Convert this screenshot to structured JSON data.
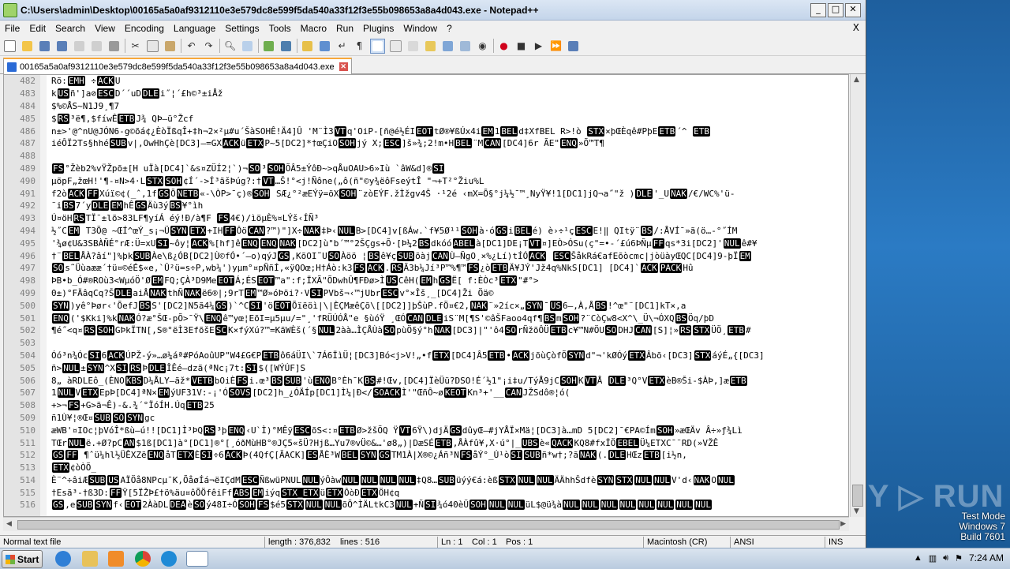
{
  "window": {
    "title": "C:\\Users\\admin\\Desktop\\00165a5a0af9312110e3e579dc8e599f5da540a33f12f3e55b098653a8a4d043.exe - Notepad++",
    "minimize": "_",
    "maximize": "□",
    "close": "✕"
  },
  "menu": [
    "File",
    "Edit",
    "Search",
    "View",
    "Encoding",
    "Language",
    "Settings",
    "Tools",
    "Macro",
    "Run",
    "Plugins",
    "Window",
    "?"
  ],
  "menu_close": "X",
  "tab": {
    "label": "00165a5a0af9312110e3e579dc8e599f5da540a33f12f3e55b098653a8a4d043.exe",
    "close": "✕"
  },
  "lines": [
    {
      "n": "482",
      "t": "Rõ:[EMH] ÷[ACK]U"
    },
    {
      "n": "483",
      "t": "k[US]ñ']a⊘[ESC]D´´uD[DLE]i˝¦´£h©³±iÅž"
    },
    {
      "n": "484",
      "t": "$%©ÅS~N1J9¸¶7"
    },
    {
      "n": "485",
      "t": "$[RS]³ë¶,$fíwÊ[ETB]J¾   QÞ—ü°Žcf"
    },
    {
      "n": "486",
      "t": "n±>'@^nU@JÓN6-g©õá¢¿ÈòÏßqÎ+‡h¬2×²µ#u´ŠàSOHÊ!Ä4]Û 'M¨Ì3[VT]q'OiP-[ñ@é½ÉI[EOT]tØ®¥ßÚx4i[EM]1[BEL]d‡XfBEL R>!ò  [STX]×þŒÈqê#PþE[ETB]´^  [ETB]"
    },
    {
      "n": "487",
      "t": "iéÔÏ2Ts§hhé[SUB]v|,OwHhÇè[DC3]—=GX[ACK]ü[ETX]P~5[DC2]*†œÇiO[SOH]jý     X;[ESC]]š»¾;2!m•H[BEL]¨M[CAN][DC4]6r ÃE\"[ENQ]»Õ™T¶"
    },
    {
      "n": "488",
      "t": ""
    },
    {
      "n": "489",
      "t": "[FS]°Žèb2%vŸŽpõ±[H    uÏà[DC4]`&s¤ZÜÍ2¦`)¬[SO]³[SOH]ÕÂ5±ÝôÐ~>qÅuOAU>6»Iù `âW&d]®[SI]"
    },
    {
      "n": "490",
      "t": "µõpF„žœH!'¶-¤N>4·L[STX][SOH]¢Í´->Í³ãšÞúg?:†[VT]…Š!°<j!Ñône(„ô(ñ\"©y¾ëôFseýtÎ  \"¬+T²°Žiu%L"
    },
    {
      "n": "491",
      "t": "f2ò[ACK][FF]Xúï©¢(_ˆ,1f[GS]Õ[NETB]«-\\ÒP>¯ç)®[SOH] SÆ¿°²æEÝÿ=öX[SOH]¨zòEÝF.žÌžgv4Š ·¹2é ‹mX=Õ§°j¼½¯™¸NyŸ¥!1[DC1]jQ¬a˝\"ž  )[DLE]'_U[NAK]/€/WC%'ü-"
    },
    {
      "n": "492",
      "t": "¨i[BS]7´y[DLE][EM]hÊ[GS]Äù3ý[BS]¥°ìh"
    },
    {
      "n": "493",
      "t": "Ú¤öH[RS]TÏ¯±lõ>83LF¶yíÁ   éý!Ð/à¶F     [FS]4€)/ìöµÈ%¤LÝš‹ÍÑ³"
    },
    {
      "n": "494",
      "t": "½˝C[EM] T3Ö@ ~ŒÍ^œÝ_s¡¬Ü[SYN][ETX]+IH[FF]Ôö[CAN]?™)\"]X÷[NAK]‡Þ‹[NUL]B>[DC4]v[ßÁw.`f¥5Ø¹¹[SOH]à·ó[GS]i[BEL]é) è›÷¹ç[ESC]E!‖  QItÿ¨[BS]/:ÅVÍ¯»ã(ö…-°˝ÍM"
    },
    {
      "n": "495",
      "t": "'¾ø¢U&3SBÀÑÉ°rÆ:Ü=xU[SI]~ôy¦[ACK]%[hf]ê[ENQ][ENQ][NAK][DC2]ù\"b´™°2ŠÇgs+Õ·[Þ¼2[BS]dkóó[ABEL]à[DC1]DE¡T[VT]¤]EÒ>ÓSu(ç\"=•-´£ú6ÞÑµ[FF]qs*3i[DC2]'[NUL]ê#¥"
    },
    {
      "n": "496",
      "t": "†¨[BEL]ÅÀ?âí\"]%þk[SUB]Àe\\ß¿ÓB[DC2]Ù©fÓ•´—o)qýJ[GS],KõOI˜U[SO]Àöö  ¦[BS]ê¥ç[SUB]õàj[CAN]Ù—ÑgO¸×%¿Lí)tÍÓ[ACK]  [ESC]ŠåkRá€afEõòcmc|jòüàyŒQC[DC4]9-þÏ[EM]"
    },
    {
      "n": "497",
      "t": "[SO]s˜Üùaææ´†ü¤©éÉ$«e,`Û²ü=s÷P,wb¼')yµm°¤pÑñÍ,«ÿQOœ;H†Áò:k3[FS][ACK].[RS]Ã3b¼Jí³P™%¶™[FS]¿ò[ETB]Ä¥JÝ'Jž4q%NkS[DC1] [DC4]`[ACK][PACK]Hû"
    },
    {
      "n": "498",
      "t": "ÞB•b_Ó#®ROù3<WµóÖ'Ø[EM]FQ;ÇÀ³D9Me[EOT]Á;ÉS[EOT]™a\":f;ÏXÃ\"ÕDwhÛ¶FÐø>Ì[US]CêH([EM]h[GS]Ë[   f:ÈÒc³[ETX]\"#°>"
    },
    {
      "n": "499",
      "t": "0±)°FÄâqCq?Š[DLE]aiÅ[NAK]thÑ[NAK]ë6®|;9rT[EM]™Ø»óÞöi?·V[SI]PVbš¬‹™jUbr[ESC]v°×Îš¸_[DC4]Ži Öä©"
    },
    {
      "n": "500",
      "t": "[SYN])yê°Þør‹'ÕefJ[BS]S'[DC2]N5ã4¼[GS])`^C[SI]'ö[EOT]Õïëöì|\\|ÈÇMæêÇõ\\[[DC2]]þŠùP.fÖ¤€2,[NAK]¨»2íc×„[SYN]¯[US]6—,À,Å[BS]!^œ\"¨[DC1]kT×,a"
    },
    {
      "n": "501",
      "t": "[ENQ]('$Kki]%k[NAK]Ó?æ°ŠŒ-pÕ>¯Ÿ\\[ENQ]ê™yœ¦EõI=µ5µu/=\"¸'fRÜÚÓÅ\"e §ùóŸ ¸ŒÓ[CAN][DLE]iS¨M[¶S'©âŠFaoo4qf¶[BS]m[SOH]?¨CòÇw8<X^\\_Ü\\¬ÓXQ[BS]Öq/þD"
    },
    {
      "n": "502",
      "t": "¶é˝<q¤[RS][SOH]GÞkÏTN[,S®°ëÌ3EfõšE[SC]K×fýXú?™=KãWÈš(´§[NUL]2àà…ÌÇÅÙà[SO]pùÖ§ý°h[NAK][DC3]|\"'ô4[SO]rÑžõÔÜ[ETB]c¥™N#ÖU[SO]DHJ[CAN][S]¦»[RS][STX]ÜÖ¸[ETB]#"
    },
    {
      "n": "503",
      "t": ""
    },
    {
      "n": "504",
      "t": "Óó³n¾Óc[SI]6[ACK]ÚPŽ-ý»…ø¼áª#PóAoûUP\"W4£G€P[ETB]ô6áÜI\\`7Á6ÏìÜ¦[DC3]Bó<j>V!„•f[ETX][DC4]Â5[ETB]•[ACK]jõùÇòfÕ[SYN]d\"¬'kØÓý[ETX]Âbõ‹[DC3][STX]áýÉ„{[DC3]"
    },
    {
      "n": "505",
      "t": "ñ>[NUL]±[SYN]^X[SI][RS]Þ[DLE]ÎÊé—dzã(ªNc¡7t:[SI]$([WÝÚF]S"
    },
    {
      "n": "506",
      "t": "8„ àRDLEô_(ÈNO[KBS]D¼ÅLY—ãž*[VETB]bOiÈ[FS]i.œ³[BS][SUB]'ù[ENO]B°Èh¯K[BS]#!Œv,[DC4]ÏèÜü?DSO!É´½1\"¡i‡u/TýÅ9jC[SOH]K[VT]Å [DLE]³Q°V[ETX]èB®Ši-$ÀÞ,]æ[ETB]"
    },
    {
      "n": "507",
      "t": "1[NUL]V[ETX]EpÞ[DC4]ªN×[EM]ýUF31V:-¡'Ó[SOVS][DC2]h_¿ÓÄÍp[DC1]Ì¼|Ð</[SOACK]Ì'\"ŒñÔ~ø[KEOT]Kn³+'__[CAN]JŽSdô®¦ó("
    },
    {
      "n": "508",
      "t": "+>¬[FS]+G>ä¬Ê)-&.¾´°ÏóÍH.Úq[ETB]25"
    },
    {
      "n": "509",
      "t": "ñ1Ù¥¦®Œ¤[SUB][SO][SYN]gc"
    },
    {
      "n": "510",
      "t": "æWB'¤IOc¦þVóÎ*ßù—ú!![DC1]Ì³ÞQ[RS]³þ[ENQ]‹U`Ì)°MÊÿ[ESC]õS<:¤[ETB]Ø>žšÖQ Ÿ[VT]6Ÿ\\)djÄ[GS]dûyŒ—#jYÅÏ×Mä¦[DC3]à…mD    5[DC2]¯€PA©Ím[SOH]»æŒÄv Â÷»ƒ¾Lì"
    },
    {
      "n": "511",
      "t": "TŒr[NUL]ë.+Ø?pC[AN]$1ß[DC1]à°[DC1]®°[¸óðMùHB°®JÇ5«šÜ?Hjß…Yu7®vÜ©&…'ø8„)|DæSÉ[ETB],ÅÀfû¥,X·ú°|_[UBS]è«[QACK]KQ8#fxÏÖ[EBEL]Ü¼ETXC¯¨RD(»VŽÊ"
    },
    {
      "n": "512",
      "t": "[GS][FF]  ¶ˆü¼hl½ÜÊXZë[ENQ]åT[ETX]È[SI]÷6[ACK]Þ(4QfÇ[ÃACK][ES]ÅÈ³W[BEL][SYN][GS]TM1À|X®©¿Áñ³N[FS]åÝ°_Ú¹ò[SI][SUB]ñ*w†;?ã[NAK](.[DLE]HŒz[ETB][i½n,"
    },
    {
      "n": "513",
      "t": "[ETX]¢òÒÕ_"
    },
    {
      "n": "514",
      "t": "È¨^÷âiÆ[SUB][US]AÏÖå8NPcµ¯K,ÕåøÍá¬ëIÇdM[ESC]ÑßwüPNUL[NUL]ýÔàw[NUL][NUL][NUL][NUL]‡Q8…[SUB]üýý€á:èß[STX][NUL][NUL]ÄÄhhŠdfè[SYN][STX][NUL][NUL]V'd‹[NAK]O[NUL]"
    },
    {
      "n": "515",
      "t": "†Esã³-†ß3D:[FF]Ÿ[5ÏŽÞ£†ö%äu¤ôÕÖfêiFf[ABS][EM]iýq[STX_ETX]ü[ETX]ÔòÐ[ETX]ÖH¢q"
    },
    {
      "n": "516",
      "t": "[GS],e[SUB][SYN]f‹[EOT]2ÀàDL[DEA]è[SO]ý48I÷Ó[SOH][FS]$é5[STX][NUL][NUL]õÕ^ÌÄLtkC3[NUL]+Ñ[SI]¾ó40èÜ[SOH][NUL][NUL]üL$@ü¾à[NUL][NUL][NUL][NUL][NUL][NUL][NUL][NUL]"
    }
  ],
  "status": {
    "file_type": "Normal text file",
    "length": "length : 376,832",
    "lines": "lines : 516",
    "ln": "Ln : 1",
    "col": "Col : 1",
    "pos": "Pos : 1",
    "eol": "Macintosh (CR)",
    "encoding": "ANSI",
    "mode": "INS"
  },
  "desktop": {
    "watermark": "ANY ▷ RUN",
    "test_mode": "Test Mode",
    "os": "Windows 7",
    "build": "Build 7601"
  },
  "taskbar": {
    "start": "Start",
    "clock": "7:24 AM"
  }
}
